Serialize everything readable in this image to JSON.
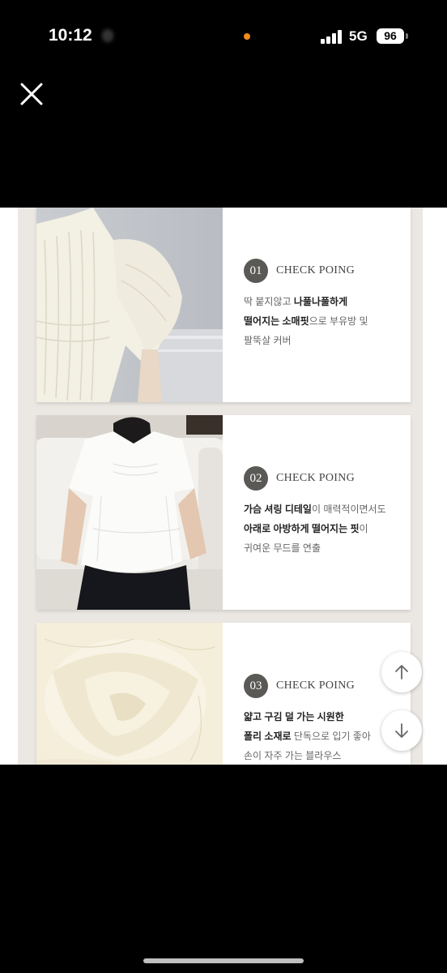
{
  "status_bar": {
    "time": "10:12",
    "network": "5G",
    "battery": "96"
  },
  "cards": [
    {
      "number": "01",
      "heading": "CHECK POING",
      "lines": [
        [
          {
            "t": "딱 붙지않고 ",
            "b": false
          },
          {
            "t": "나풀나풀하게",
            "b": true
          }
        ],
        [
          {
            "t": "떨어지는 소매핏",
            "b": true
          },
          {
            "t": "으로 부유방 및",
            "b": false
          }
        ],
        [
          {
            "t": "팔뚝살 커버",
            "b": false
          }
        ]
      ]
    },
    {
      "number": "02",
      "heading": "CHECK POING",
      "lines": [
        [
          {
            "t": "가슴 셔링 디테일",
            "b": true
          },
          {
            "t": "이 매력적이면서도",
            "b": false
          }
        ],
        [
          {
            "t": "아래로 아방하게 떨어지는 핏",
            "b": true
          },
          {
            "t": "이",
            "b": false
          }
        ],
        [
          {
            "t": " 귀여운 무드를 연출",
            "b": false
          }
        ]
      ]
    },
    {
      "number": "03",
      "heading": "CHECK POING",
      "lines": [
        [
          {
            "t": "얇고 구김 덜 가는 시원한",
            "b": true
          }
        ],
        [
          {
            "t": "폴리 소재로",
            "b": true
          },
          {
            "t": " 단독으로 입기 좋아",
            "b": false
          }
        ],
        [
          {
            "t": "손이 자주 가는 블라우스",
            "b": false
          }
        ]
      ]
    }
  ],
  "icons": {
    "close": "close-icon",
    "up": "arrow-up-icon",
    "down": "arrow-down-icon"
  },
  "colors": {
    "badge": "#5b5956",
    "frame": "#ebe8e3"
  }
}
